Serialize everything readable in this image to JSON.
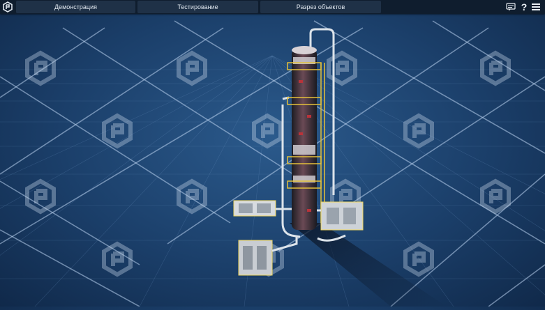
{
  "header": {
    "tabs": [
      {
        "label": "Демонстрация"
      },
      {
        "label": "Тестирование"
      },
      {
        "label": "Разрез объектов"
      }
    ],
    "icons": [
      "app-logo-icon",
      "chat-icon",
      "help-icon",
      "menu-icon"
    ],
    "help_glyph": "?"
  },
  "colors": {
    "topbar_bg": "#0f1d2e",
    "tab_bg": "#1f3147",
    "scene_bg": "#1b3f6a",
    "grid_line": "#8fb3db"
  }
}
